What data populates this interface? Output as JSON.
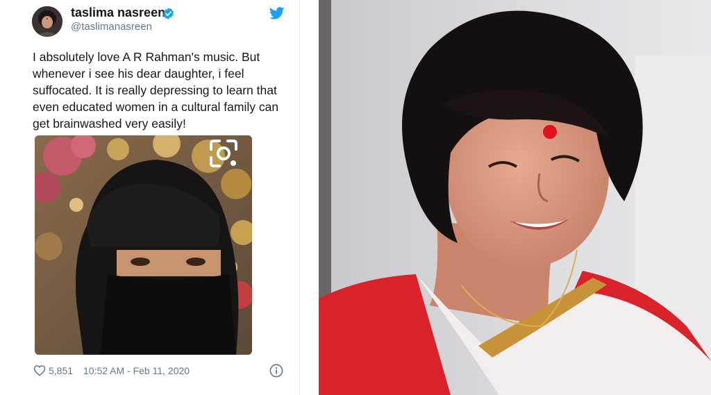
{
  "tweet": {
    "author_name": "taslima nasreen",
    "author_handle": "@taslimanasreen",
    "text": "I absolutely love A R Rahman's music. But\nwhenever i see his dear daughter, i feel\nsuffocated. It is really depressing to learn that\neven  educated women in a  cultural family can\nget brainwashed very easily!",
    "likes": "5,851",
    "timestamp": "10:52 AM - Feb 11, 2020"
  },
  "icons": {
    "verified": "verified-badge-icon",
    "brand": "twitter-bird-icon",
    "like": "heart-icon",
    "info": "info-icon",
    "lens": "google-lens-icon"
  },
  "colors": {
    "brand_blue": "#1da1f2",
    "text_primary": "#14171a",
    "text_secondary": "#657786",
    "bindi_red": "#e0101c",
    "saree_red": "#d9222a"
  }
}
